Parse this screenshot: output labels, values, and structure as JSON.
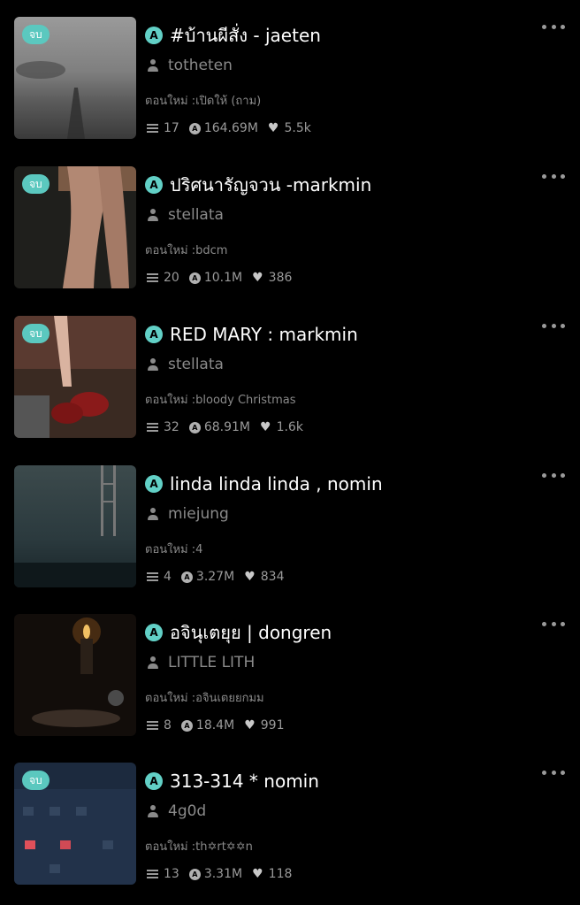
{
  "labels": {
    "update_prefix": "ตอนใหม่ :"
  },
  "colors": {
    "accent": "#5bc8bf",
    "background": "#000000",
    "muted_text": "#8a8a8a"
  },
  "icons": {
    "more": "more-icon",
    "author": "user-icon",
    "parts": "list-icon",
    "reads": "reads-icon",
    "votes": "heart-icon",
    "story_type": "a-icon"
  },
  "stories": [
    {
      "badge": "จบ",
      "title": "#บ้านผีสั่ง - jaeten",
      "author": "totheten",
      "update": "ตอนใหม่ :เปิดให้ (ถาม)",
      "parts": "17",
      "reads": "164.69M",
      "votes": "5.5k"
    },
    {
      "badge": "จบ",
      "title": "ปริศนารัญจวน -markmin",
      "author": "stellata",
      "update": "ตอนใหม่ :bdcm",
      "parts": "20",
      "reads": "10.1M",
      "votes": "386"
    },
    {
      "badge": "จบ",
      "title": "RED MARY : markmin",
      "author": "stellata",
      "update": "ตอนใหม่ :bloody Christmas",
      "parts": "32",
      "reads": "68.91M",
      "votes": "1.6k"
    },
    {
      "badge": "",
      "title": "linda linda linda , nomin",
      "author": "miejung",
      "update": "ตอนใหม่ :4",
      "parts": "4",
      "reads": "3.27M",
      "votes": "834"
    },
    {
      "badge": "",
      "title": "อจินุเตยุย | dongren",
      "author": "LITTLE LITH",
      "update": "ตอนใหม่ :อจินเตยยกมม",
      "parts": "8",
      "reads": "18.4M",
      "votes": "991"
    },
    {
      "badge": "จบ",
      "title": "313-314 * nomin",
      "author": "4g0d",
      "update": "ตอนใหม่ :th✡rt✡✡n",
      "parts": "13",
      "reads": "3.31M",
      "votes": "118"
    }
  ]
}
